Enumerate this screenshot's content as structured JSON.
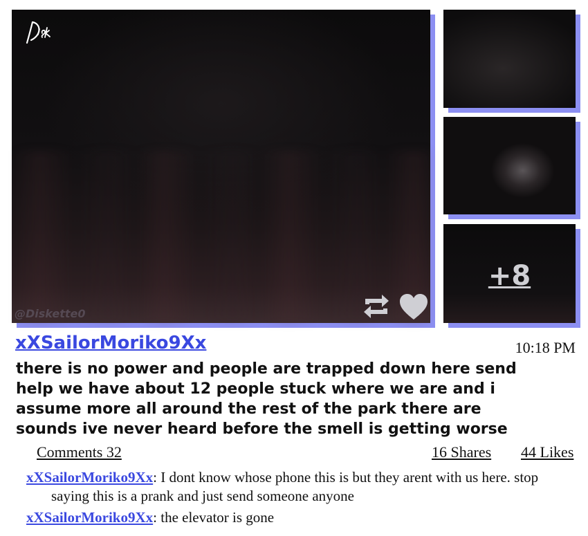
{
  "post": {
    "author": "xXSailorMoriko9Xx",
    "time": "10:18 PM",
    "text": "there is no power and people are trapped down here send help we have about 12 people stuck where we are and i assume more all around the rest of the park there are sounds ive never heard before the smell is getting worse",
    "watermark": "@Diskette0",
    "logo_text": "Disk",
    "more_photos": "+8",
    "comments_label": "Comments 32",
    "shares_label": "16 Shares",
    "likes_label": "44 Likes"
  },
  "icons": {
    "repost": "repost-icon",
    "like": "heart-icon"
  },
  "comments": [
    {
      "author": "xXSailorMoriko9Xx",
      "sep": ": ",
      "text": "I dont know whose phone this is but they arent with us here. stop saying this is a prank and just send someone anyone"
    },
    {
      "author": "xXSailorMoriko9Xx",
      "sep": ": ",
      "text": "the elevator is gone"
    }
  ],
  "colors": {
    "accent": "#3a48e0",
    "shadow": "#8c8ff2"
  }
}
